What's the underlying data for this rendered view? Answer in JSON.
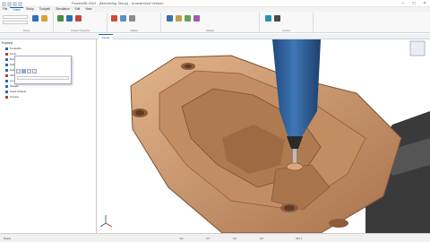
{
  "app": {
    "title": "PowerMill 2022 - [Machining Setup] - Unrestricted Version",
    "brand_color": "#1e5fa8",
    "part_color": "#c9956b",
    "tool_color": "#2f5f9a"
  },
  "ribbon": {
    "tabs": [
      {
        "label": "File",
        "active": false
      },
      {
        "label": "Home",
        "active": true
      },
      {
        "label": "Setup",
        "active": false
      },
      {
        "label": "Toolpath",
        "active": false
      },
      {
        "label": "Simulation",
        "active": false
      },
      {
        "label": "Edit",
        "active": false
      },
      {
        "label": "View",
        "active": false
      }
    ],
    "groups": [
      {
        "label": "Setup"
      },
      {
        "label": "Create Toolpaths"
      },
      {
        "label": "Utilities"
      },
      {
        "label": "Display"
      },
      {
        "label": "Output"
      }
    ]
  },
  "browser": {
    "title": "Explorer"
  },
  "tree": {
    "rows": [
      {
        "label": "Toolpaths",
        "icon": "folder-icon"
      },
      {
        "label": "Tools",
        "icon": "tool-icon"
      },
      {
        "label": "Boundaries",
        "icon": "boundary-icon"
      },
      {
        "label": "Patterns",
        "icon": "pattern-icon"
      },
      {
        "label": "Feature Sets",
        "icon": "feature-icon"
      },
      {
        "label": "Workplanes",
        "icon": "workplane-icon"
      },
      {
        "label": "Levels and Sets",
        "icon": "level-icon"
      },
      {
        "label": "Models",
        "icon": "model-icon"
      },
      {
        "label": "Stock Models",
        "icon": "stock-icon"
      },
      {
        "label": "Groups",
        "icon": "group-icon"
      }
    ]
  },
  "document": {
    "tab_label": "Model"
  },
  "status": {
    "items": [
      "Ready",
      "mm",
      "0.0",
      "0.0",
      "0.0",
      "ISO 1"
    ]
  }
}
